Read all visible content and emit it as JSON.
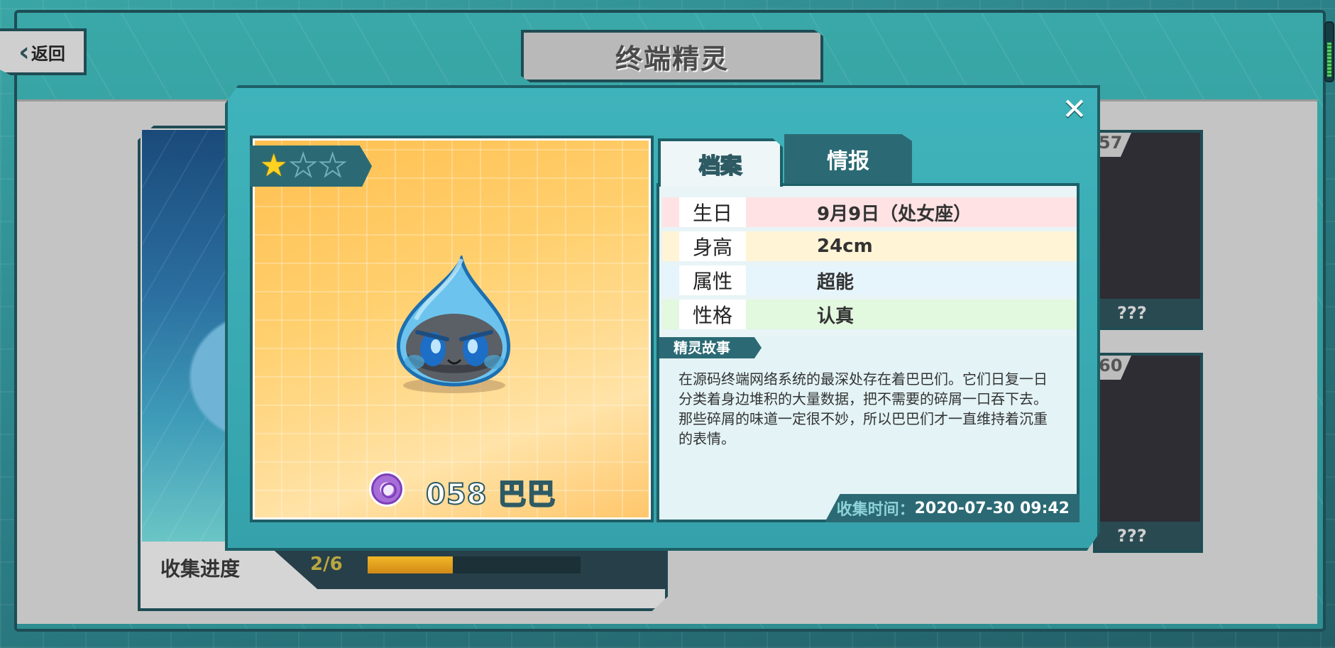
{
  "header": {
    "back_label": "返回",
    "title": "终端精灵"
  },
  "collection": {
    "label": "收集进度",
    "count": "2/6",
    "fraction": 0.4
  },
  "side_cards": [
    {
      "number": "57",
      "name": "???"
    },
    {
      "number": "60",
      "name": "???"
    }
  ],
  "spirit": {
    "stars_total": 3,
    "stars_filled": 1,
    "number_name": "058 巴巴",
    "type_icon": "psychic-type-icon"
  },
  "tabs": [
    {
      "label": "档案",
      "active": true
    },
    {
      "label": "情报",
      "active": false
    }
  ],
  "profile": {
    "birthday": {
      "key": "生日",
      "value": "9月9日（处女座）"
    },
    "height": {
      "key": "身高",
      "value": "24cm"
    },
    "attribute": {
      "key": "属性",
      "value": "超能"
    },
    "nature": {
      "key": "性格",
      "value": "认真"
    }
  },
  "story": {
    "tag": "精灵故事",
    "text": "在源码终端网络系统的最深处存在着巴巴们。它们日复一日分类着身边堆积的大量数据，把不需要的碎屑一口吞下去。那些碎屑的味道一定很不妙，所以巴巴们才一直维持着沉重的表情。"
  },
  "collect_time": {
    "label": "收集时间：",
    "value": "2020-07-30 09:42"
  },
  "close_icon": "close-icon",
  "colors": {
    "accent": "#3fb3bb",
    "dark": "#2b6a74",
    "portrait_bg": "#ffd06f"
  }
}
